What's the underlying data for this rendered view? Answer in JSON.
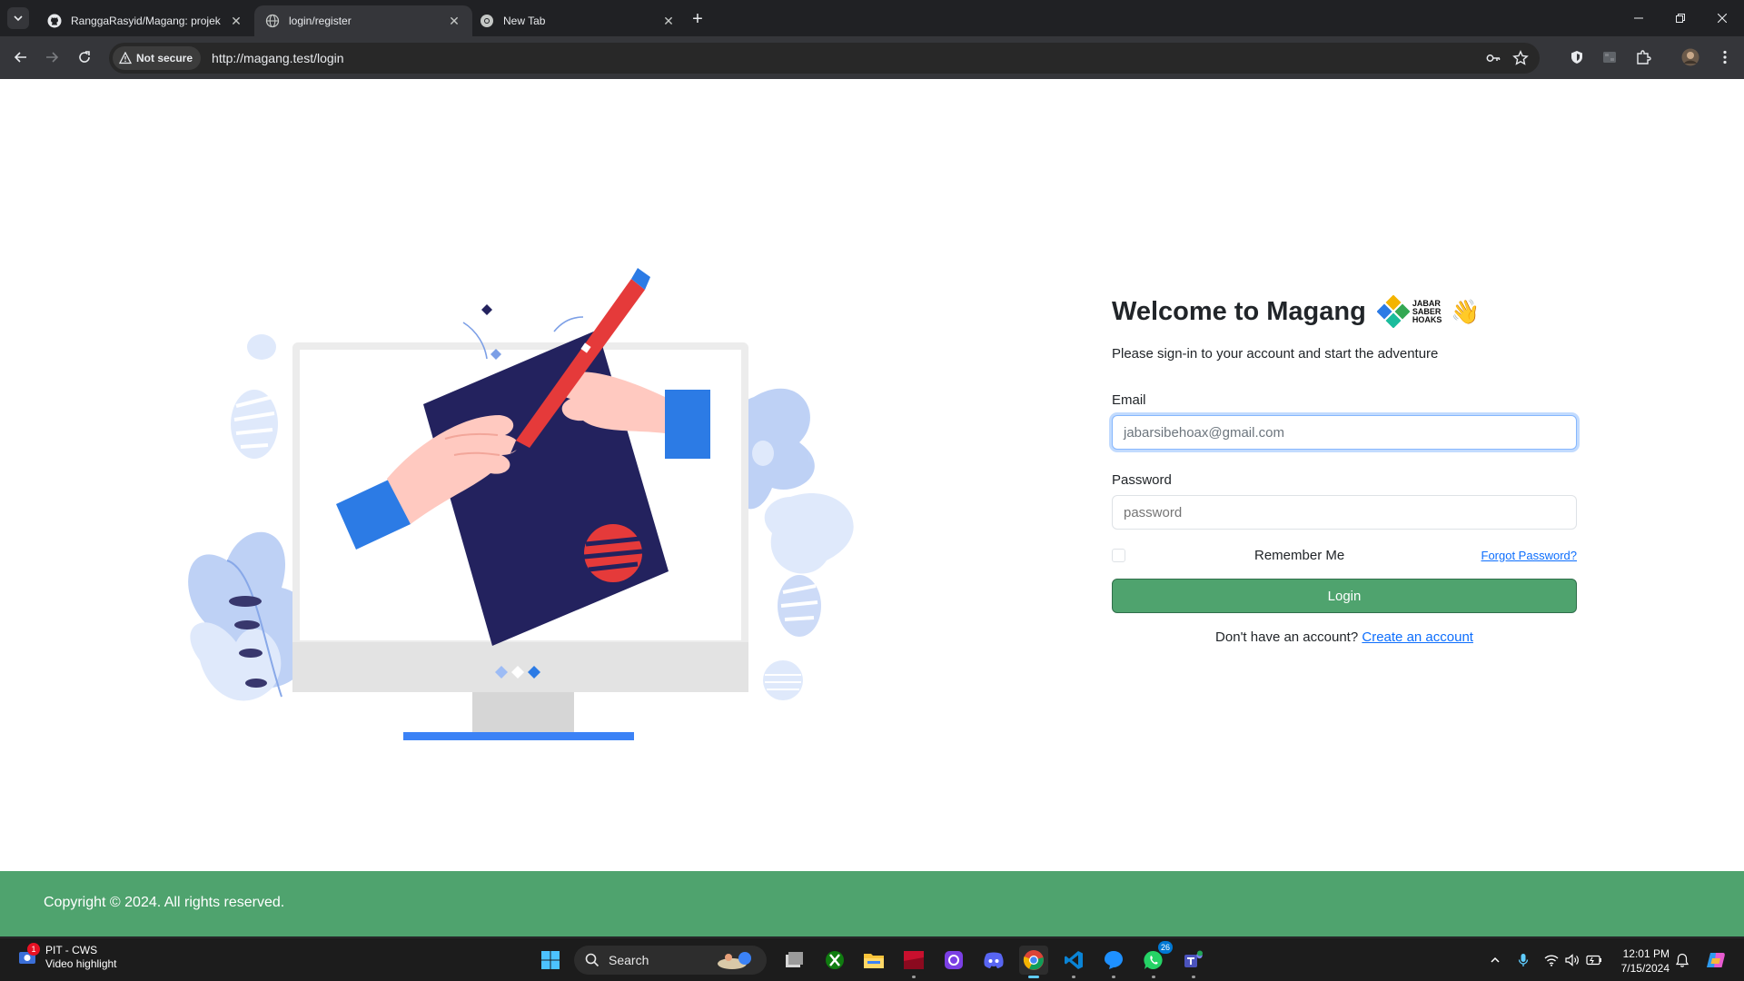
{
  "browser": {
    "tabs": [
      {
        "title": "RanggaRasyid/Magang: projek",
        "favicon": "github-icon",
        "active": false
      },
      {
        "title": "login/register",
        "favicon": "globe-icon",
        "active": true
      },
      {
        "title": "New Tab",
        "favicon": "chrome-icon",
        "active": false
      }
    ],
    "security_label": "Not secure",
    "url": "http://magang.test/login"
  },
  "page": {
    "heading": "Welcome to Magang",
    "brand_logo_text": [
      "JABAR",
      "SABER",
      "HOAKS"
    ],
    "wave_emoji": "👋",
    "subtitle": "Please sign-in to your account and start the adventure",
    "email": {
      "label": "Email",
      "value": "jabarsibehoax@gmail.com"
    },
    "password": {
      "label": "Password",
      "placeholder": "password"
    },
    "remember_label": "Remember Me",
    "forgot_link": "Forgot Password?",
    "login_button": "Login",
    "signup_prompt": "Don't have an account?",
    "signup_link": "Create an account",
    "footer_text": "Copyright © 2024. All rights reserved.",
    "colors": {
      "primary": "#4fa36e",
      "link": "#0d6efd",
      "illustration_navy": "#23225e",
      "illustration_blue": "#2c7be5",
      "illustration_red": "#e53a3a"
    }
  },
  "taskbar": {
    "notification": {
      "badge": "1",
      "title": "PIT - CWS",
      "subtitle": "Video highlight"
    },
    "search_label": "Search",
    "apps": [
      {
        "name": "start-button"
      },
      {
        "name": "task-view"
      },
      {
        "name": "xbox"
      },
      {
        "name": "file-explorer"
      },
      {
        "name": "red-app"
      },
      {
        "name": "purple-app"
      },
      {
        "name": "discord"
      },
      {
        "name": "chrome",
        "active": true
      },
      {
        "name": "vscode"
      },
      {
        "name": "blue-app"
      },
      {
        "name": "whatsapp",
        "badge": "26"
      },
      {
        "name": "teams"
      }
    ],
    "time": "12:01 PM",
    "date": "7/15/2024"
  }
}
